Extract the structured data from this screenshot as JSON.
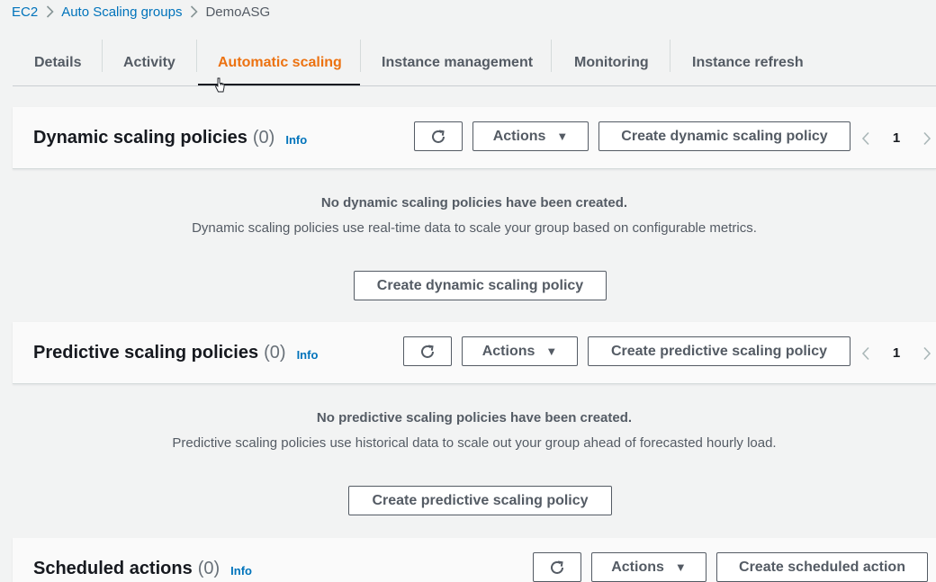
{
  "breadcrumb": {
    "items": [
      {
        "label": "EC2"
      },
      {
        "label": "Auto Scaling groups"
      },
      {
        "label": "DemoASG"
      }
    ]
  },
  "tabs": [
    {
      "label": "Details"
    },
    {
      "label": "Activity"
    },
    {
      "label": "Automatic scaling",
      "active": true
    },
    {
      "label": "Instance management"
    },
    {
      "label": "Monitoring"
    },
    {
      "label": "Instance refresh"
    }
  ],
  "dynamic": {
    "title": "Dynamic scaling policies",
    "count": "(0)",
    "info": "Info",
    "actions_label": "Actions",
    "create_label": "Create dynamic scaling policy",
    "page": "1",
    "empty_title": "No dynamic scaling policies have been created.",
    "empty_desc": "Dynamic scaling policies use real-time data to scale your group based on configurable metrics.",
    "empty_button": "Create dynamic scaling policy"
  },
  "predictive": {
    "title": "Predictive scaling policies",
    "count": "(0)",
    "info": "Info",
    "actions_label": "Actions",
    "create_label": "Create predictive scaling policy",
    "page": "1",
    "empty_title": "No predictive scaling policies have been created.",
    "empty_desc": "Predictive scaling policies use historical data to scale out your group ahead of forecasted hourly load.",
    "empty_button": "Create predictive scaling policy"
  },
  "scheduled": {
    "title": "Scheduled actions",
    "count": "(0)",
    "info": "Info",
    "actions_label": "Actions",
    "create_label": "Create scheduled action"
  },
  "icons": {
    "breadcrumb_separator": "chevron-right-icon",
    "refresh": "refresh-icon",
    "dropdown": "caret-down-icon",
    "pager_prev": "chevron-left-icon",
    "pager_next": "chevron-right-icon",
    "cursor": "mouse-pointer-icon"
  },
  "colors": {
    "link": "#0073bb",
    "active_tab": "#ec7211",
    "text": "#16191f",
    "muted_text": "#545b64",
    "background": "#f2f3f3"
  }
}
